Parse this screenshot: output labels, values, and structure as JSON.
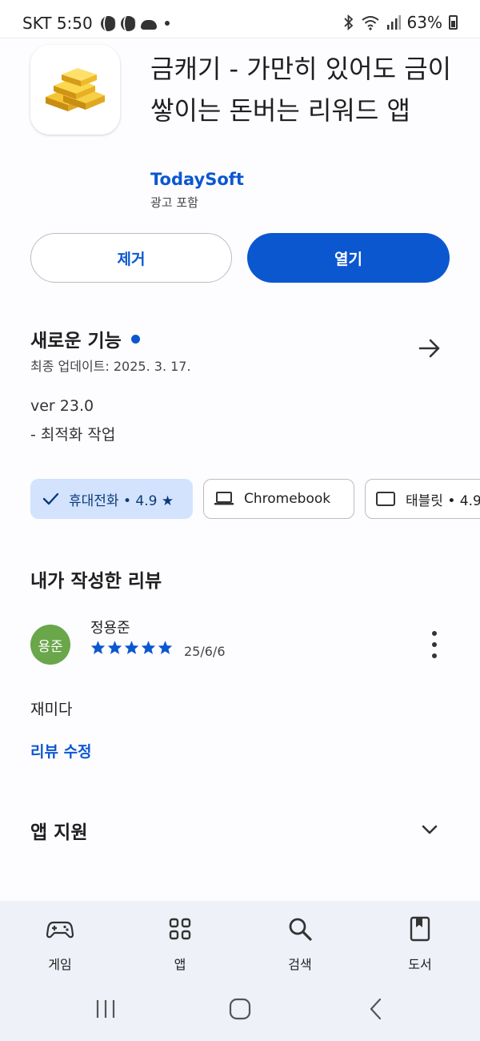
{
  "status_bar": {
    "carrier_time": "SKT 5:50",
    "battery": "63%"
  },
  "app": {
    "title": "금캐기 - 가만히 있어도 금이 쌓이는 돈버는 리워드 앱",
    "developer": "TodaySoft",
    "ads_note": "광고 포함",
    "icon": "gold-bars-icon"
  },
  "actions": {
    "uninstall_label": "제거",
    "open_label": "열기"
  },
  "whats_new": {
    "title": "새로운 기능",
    "updated": "최종 업데이트: 2025. 3. 17.",
    "version": "ver 23.0",
    "notes": "- 최적화 작업"
  },
  "device_chips": [
    {
      "label": "휴대전화 • 4.9 ★",
      "selected": true,
      "icon": "check-icon"
    },
    {
      "label": "Chromebook",
      "selected": false,
      "icon": "laptop-icon"
    },
    {
      "label": "태블릿 • 4.9",
      "selected": false,
      "icon": "tablet-icon"
    }
  ],
  "my_review": {
    "section_title": "내가 작성한 리뷰",
    "avatar_text": "용준",
    "reviewer": "정용준",
    "rating": 5,
    "date": "25/6/6",
    "text": "재미다",
    "edit_label": "리뷰 수정"
  },
  "app_support": {
    "title": "앱 지원"
  },
  "bottom_nav": [
    {
      "label": "게임",
      "icon": "gamepad-icon"
    },
    {
      "label": "앱",
      "icon": "apps-grid-icon"
    },
    {
      "label": "검색",
      "icon": "search-icon"
    },
    {
      "label": "도서",
      "icon": "book-icon"
    }
  ],
  "colors": {
    "accent": "#0b57d0",
    "chip_selected": "#d3e3fd",
    "avatar": "#6aa64a",
    "nav_bg": "#eef1f8"
  }
}
